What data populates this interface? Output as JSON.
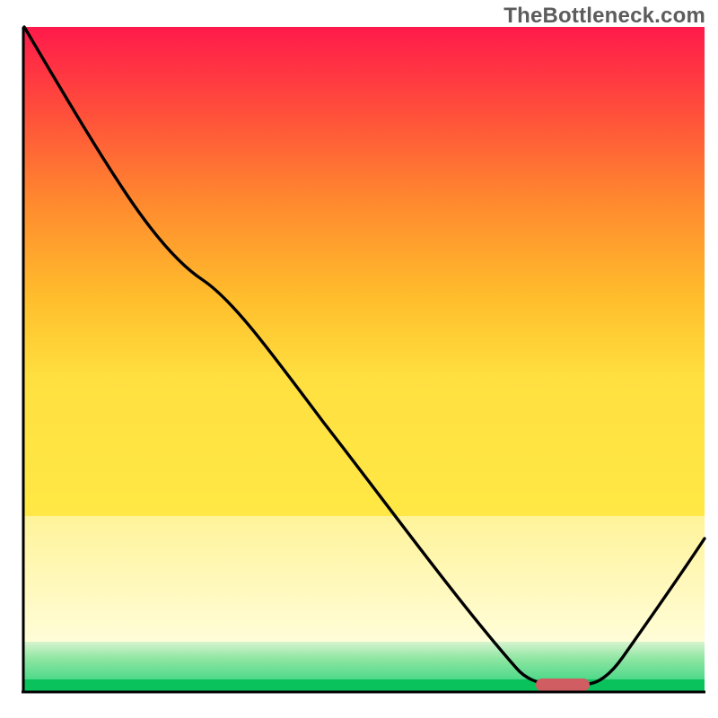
{
  "watermark": "TheBottleneck.com",
  "chart_data": {
    "type": "line",
    "title": "",
    "xlabel": "",
    "ylabel": "",
    "xlim": [
      0,
      100
    ],
    "ylim": [
      0,
      100
    ],
    "x": [
      0,
      13,
      25,
      74,
      82,
      100
    ],
    "values": [
      100,
      80,
      72,
      0,
      0,
      26
    ],
    "marker": {
      "x_start": 74,
      "x_end": 82,
      "y": 0
    },
    "background_bands": [
      {
        "y_top": 100,
        "y_bottom": 27,
        "color_top": "#ff1a4b",
        "color_bottom": "#ffd232"
      },
      {
        "y_top": 27,
        "y_bottom": 9,
        "color_top": "#ffd232",
        "color_bottom": "#fffcc0"
      },
      {
        "y_top": 9,
        "y_bottom": 3,
        "color_top": "#fffcc0",
        "color_bottom": "#9de8a8"
      },
      {
        "y_top": 3,
        "y_bottom": 0,
        "color_top": "#35d472",
        "color_bottom": "#08c15a"
      }
    ],
    "colors": {
      "line": "#000000",
      "marker": "#cf5d61",
      "axis": "#000000"
    }
  }
}
